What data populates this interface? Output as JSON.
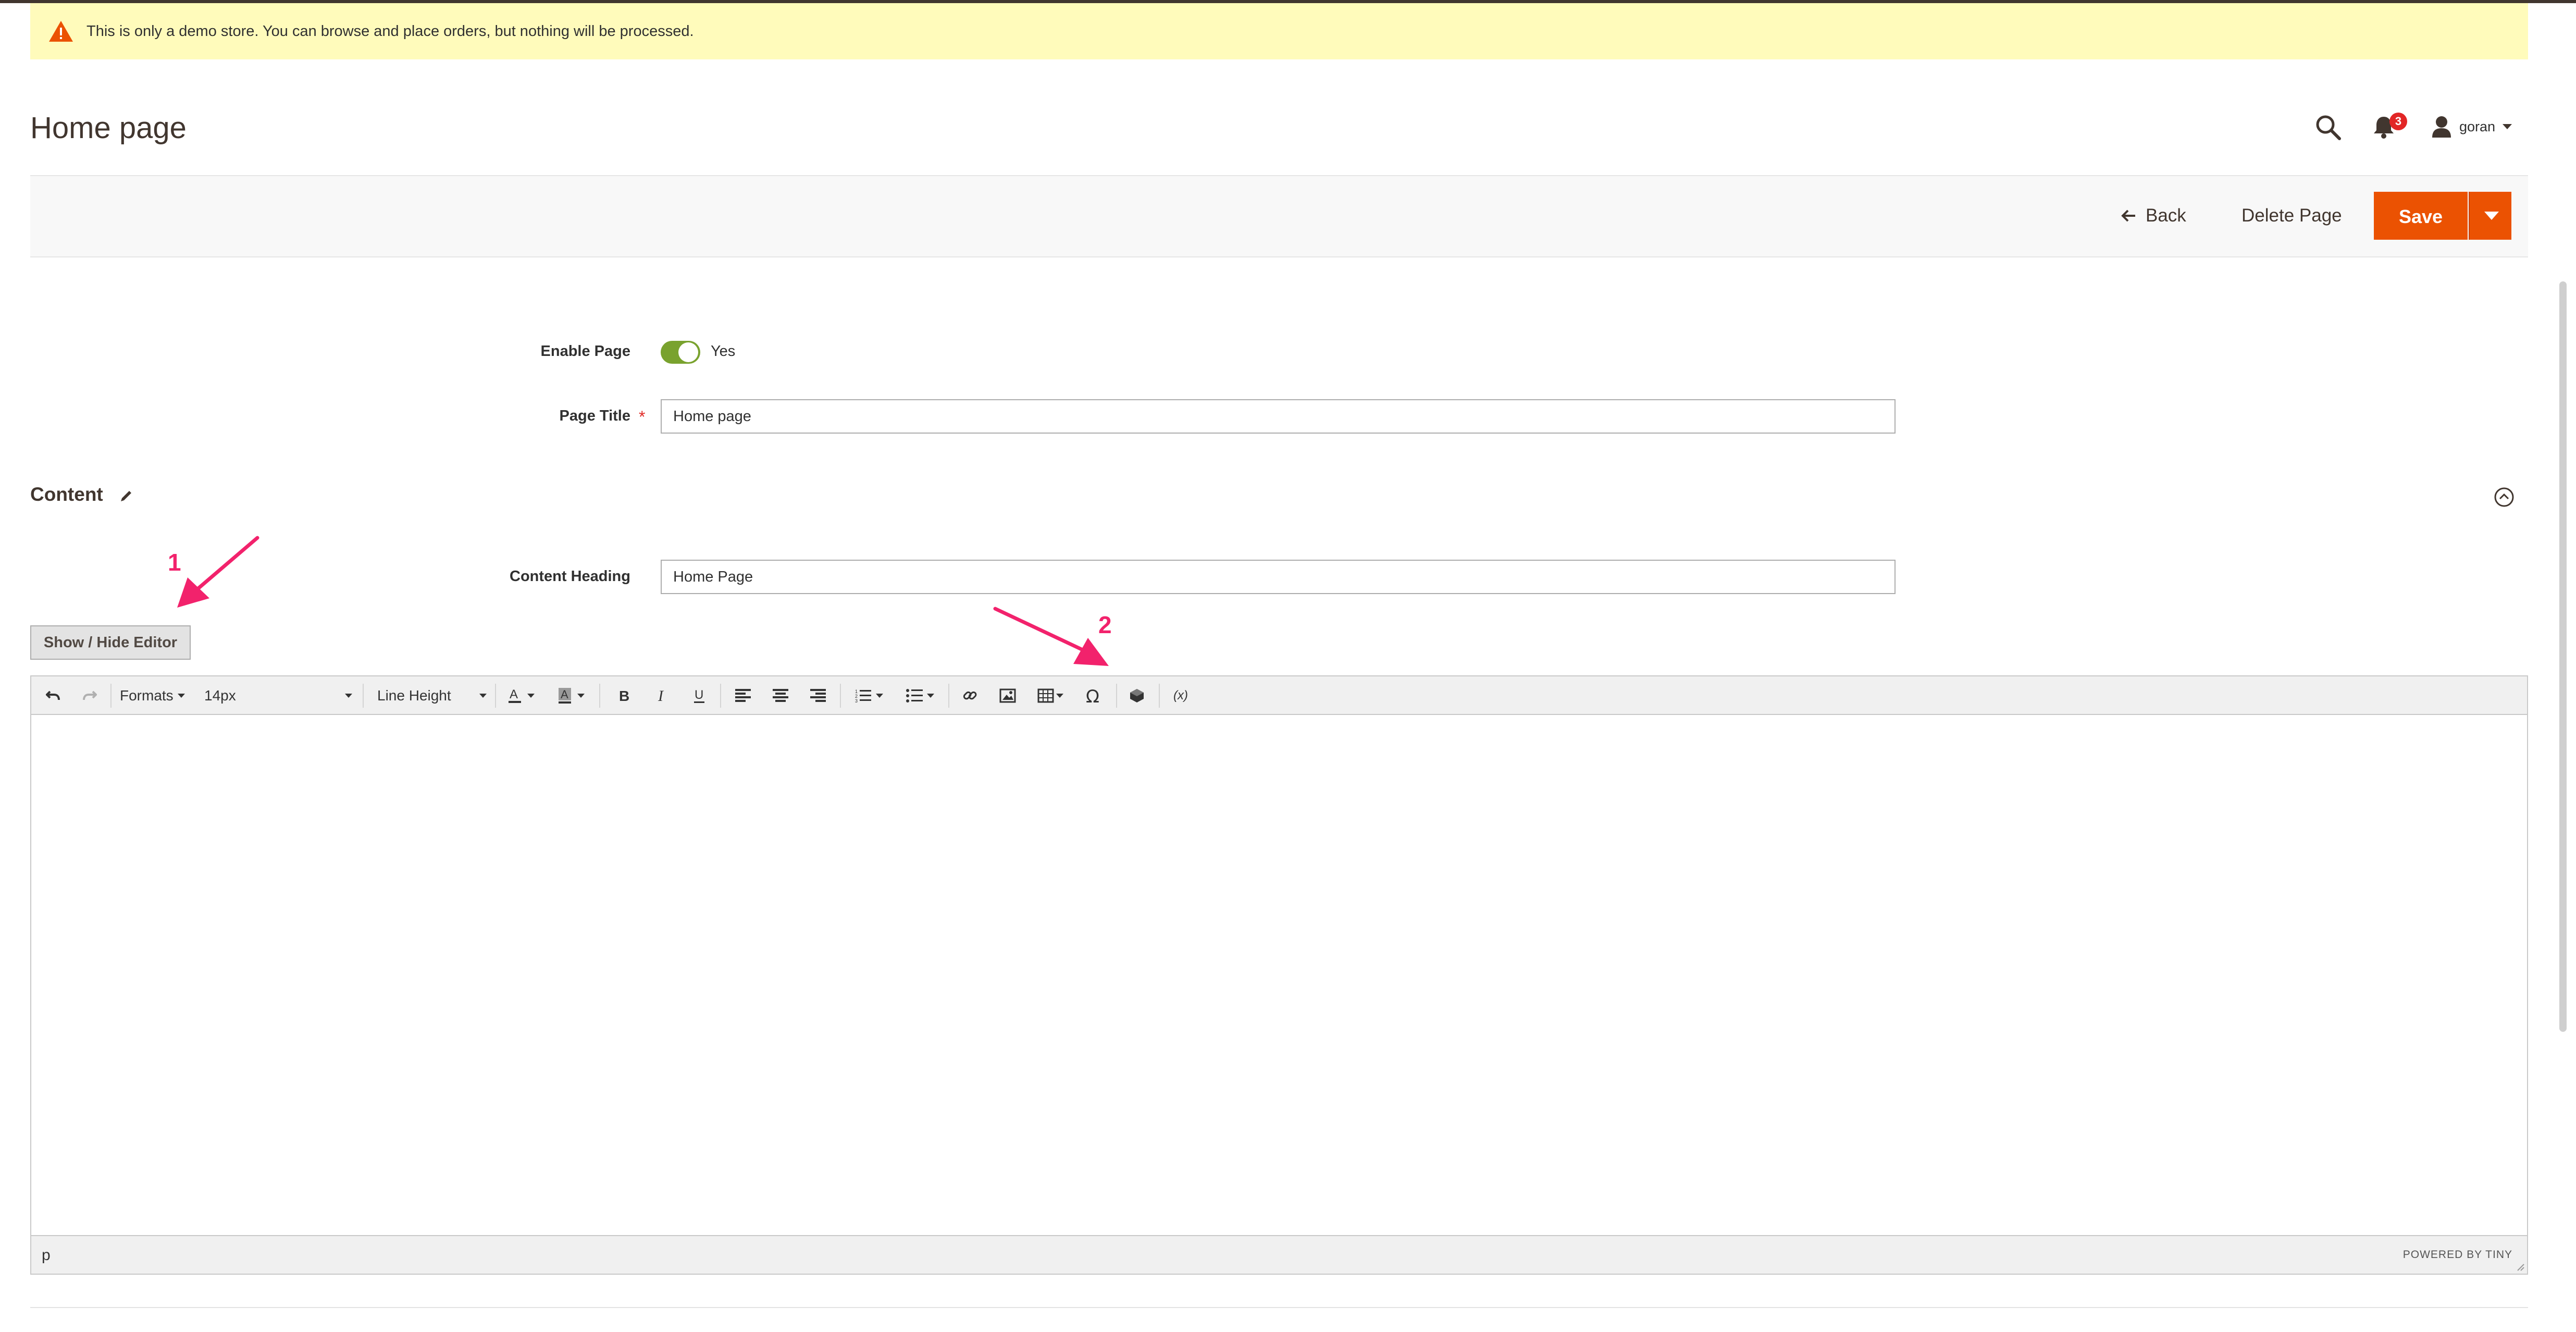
{
  "notice": {
    "text": "This is only a demo store. You can browse and place orders, but nothing will be processed.",
    "icon": "warning-icon"
  },
  "header": {
    "title": "Home page",
    "notifications_count": "3",
    "user_name": "goran"
  },
  "actions": {
    "back": "Back",
    "delete": "Delete Page",
    "save": "Save"
  },
  "form": {
    "enable_page_label": "Enable Page",
    "enable_page_value": "Yes",
    "page_title_label": "Page Title",
    "page_title_value": "Home page",
    "content_heading_label": "Content Heading",
    "content_heading_value": "Home Page"
  },
  "content_section": {
    "title": "Content",
    "show_hide_editor": "Show / Hide Editor"
  },
  "annotations": {
    "marker_1": "1",
    "marker_2": "2"
  },
  "editor": {
    "toolbar": {
      "formats": "Formats",
      "font_size": "14px",
      "line_height": "Line Height",
      "variable": "(x)"
    },
    "status_path": "p",
    "powered_by": "POWERED BY TINY"
  },
  "colors": {
    "accent": "#eb5202",
    "toggle_on": "#79a22e",
    "annotation": "#f2226c",
    "notice_bg": "#fffbbb"
  }
}
